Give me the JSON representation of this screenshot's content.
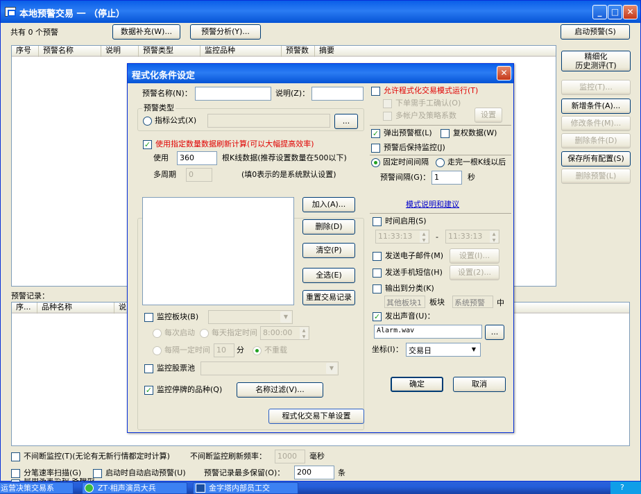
{
  "window": {
    "title": "本地预警交易 一 （停止）"
  },
  "toolbar": {
    "count_label": "共有 0 个预警",
    "supplement_btn": "数据补充(W)...",
    "analysis_btn": "预警分析(Y)..."
  },
  "alert_list": {
    "headers": [
      "序号",
      "预警名称",
      "说明",
      "预警类型",
      "监控品种",
      "预警数",
      "摘要"
    ]
  },
  "side": {
    "start_btn": "启动预警(S)",
    "refine_btn_line1": "精细化",
    "refine_btn_line2": "历史测评(T)",
    "monitor_btn": "监控(T)...",
    "add_btn": "新增条件(A)...",
    "modify_btn": "修改条件(M)...",
    "delete_btn": "删除条件(D)",
    "save_btn": "保存所有配置(S)",
    "delete_alert_btn": "删除预警(L)"
  },
  "records": {
    "label": "预警记录：",
    "headers": [
      "序...",
      "品种名称",
      "说"
    ]
  },
  "bottom": {
    "continuous_label": "不间断监控(T)(无论有无新行情都定时计算)",
    "freq_label": "不间断监控刷新频率：",
    "freq_value": "1000",
    "freq_unit": "毫秒",
    "tick_label": "分笔速率扫描(G)",
    "autostart_label": "启动时自动启动预警(U)",
    "keep_label": "预警记录最多保留(O)：",
    "keep_value": "200",
    "keep_unit": "条",
    "partial_label": "启用多笔监控 各模型..."
  },
  "dialog": {
    "title": "程式化条件设定",
    "name_label": "预警名称(N)：",
    "name_value": "",
    "desc_label": "说明(Z)：",
    "desc_value": "",
    "type_group": "预警类型",
    "formula_label": "指标公式(X)",
    "browse_btn": "...",
    "use_data_label": "使用指定数量数据刷新计算(可以大幅提高效率)",
    "use_label": "使用",
    "bars_value": "360",
    "bars_label": "根K线数据(推荐设置数量在500以下)",
    "period_label": "多周期",
    "period_value": "0",
    "zero_hint": "(填0表示的是系统默认设置)",
    "add_btn": "加入(A)...",
    "remove_btn": "删除(D)",
    "clear_btn": "清空(P)",
    "select_all_btn": "全选(E)",
    "reset_btn": "重置交易记录",
    "sector_label": "监控板块(B)",
    "each_start_label": "每次启动",
    "daily_label": "每天指定时间",
    "daily_time": "8:00:00",
    "interval_label": "每隔一定时间",
    "interval_value": "10",
    "interval_unit": "分",
    "no_reload_label": "不重载",
    "pool_label": "监控股票池",
    "suspended_label": "监控停牌的品种(Q)",
    "name_filter_btn": "名称过滤(V)...",
    "order_btn": "程式化交易下单设置",
    "allow_trade_label": "允许程式化交易模式运行(T)",
    "manual_confirm_label": "下单需手工确认(O)",
    "multi_account_label": "多帐户及策略系数",
    "setting_btn": "设置",
    "popup_label": "弹出预警框(L)",
    "adjust_label": "复权数据(W)",
    "keep_monitor_label": "预警后保持监控(J)",
    "fixed_interval_label": "固定时间间隔",
    "bar_finish_label": "走完一根K线以后",
    "alert_interval_label": "预警间隔(G)：",
    "alert_interval_value": "1",
    "alert_interval_unit": "秒",
    "mode_link": "模式说明和建议",
    "time_enable_label": "时间启用(S)",
    "time_start": "11:33:13",
    "time_dash": "-",
    "time_end": "11:33:13",
    "email_label": "发送电子邮件(M)",
    "email_setting_btn": "设置(I)...",
    "sms_label": "发送手机短信(H)",
    "sms_setting_btn": "设置(2)...",
    "output_class_label": "输出到分类(K)",
    "other_sector": "其他板块1",
    "sector_word": "板块",
    "system_alert": "系统预警",
    "middle_word": "中",
    "sound_label": "发出声音(U)：",
    "sound_file": "Alarm.wav",
    "sound_browse_btn": "...",
    "coord_label": "坐标(I)：",
    "coord_value": "交易日",
    "ok_btn": "确定",
    "cancel_btn": "取消"
  },
  "taskbar": {
    "item1": "运营决策交易系",
    "item2": "ZT·相声演员大兵",
    "item3": "金字塔内部员工交"
  }
}
